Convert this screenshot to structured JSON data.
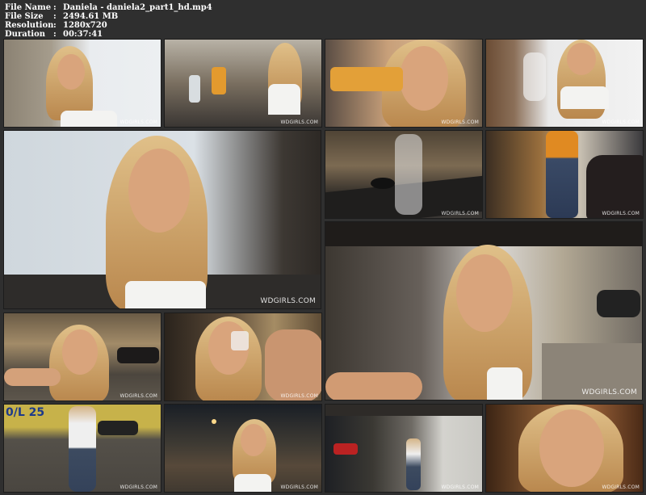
{
  "file_info": {
    "name_label": "File Name",
    "name_value": "Daniela - daniela2_part1_hd.mp4",
    "size_label": "File Size",
    "size_value": "2494.61 MB",
    "resolution_label": "Resolution",
    "resolution_value": "1280x720",
    "duration_label": "Duration",
    "duration_value": "00:37:41",
    "separator": ":"
  },
  "watermark": "WDGIRLS.COM",
  "sign_text": "0/L 25"
}
